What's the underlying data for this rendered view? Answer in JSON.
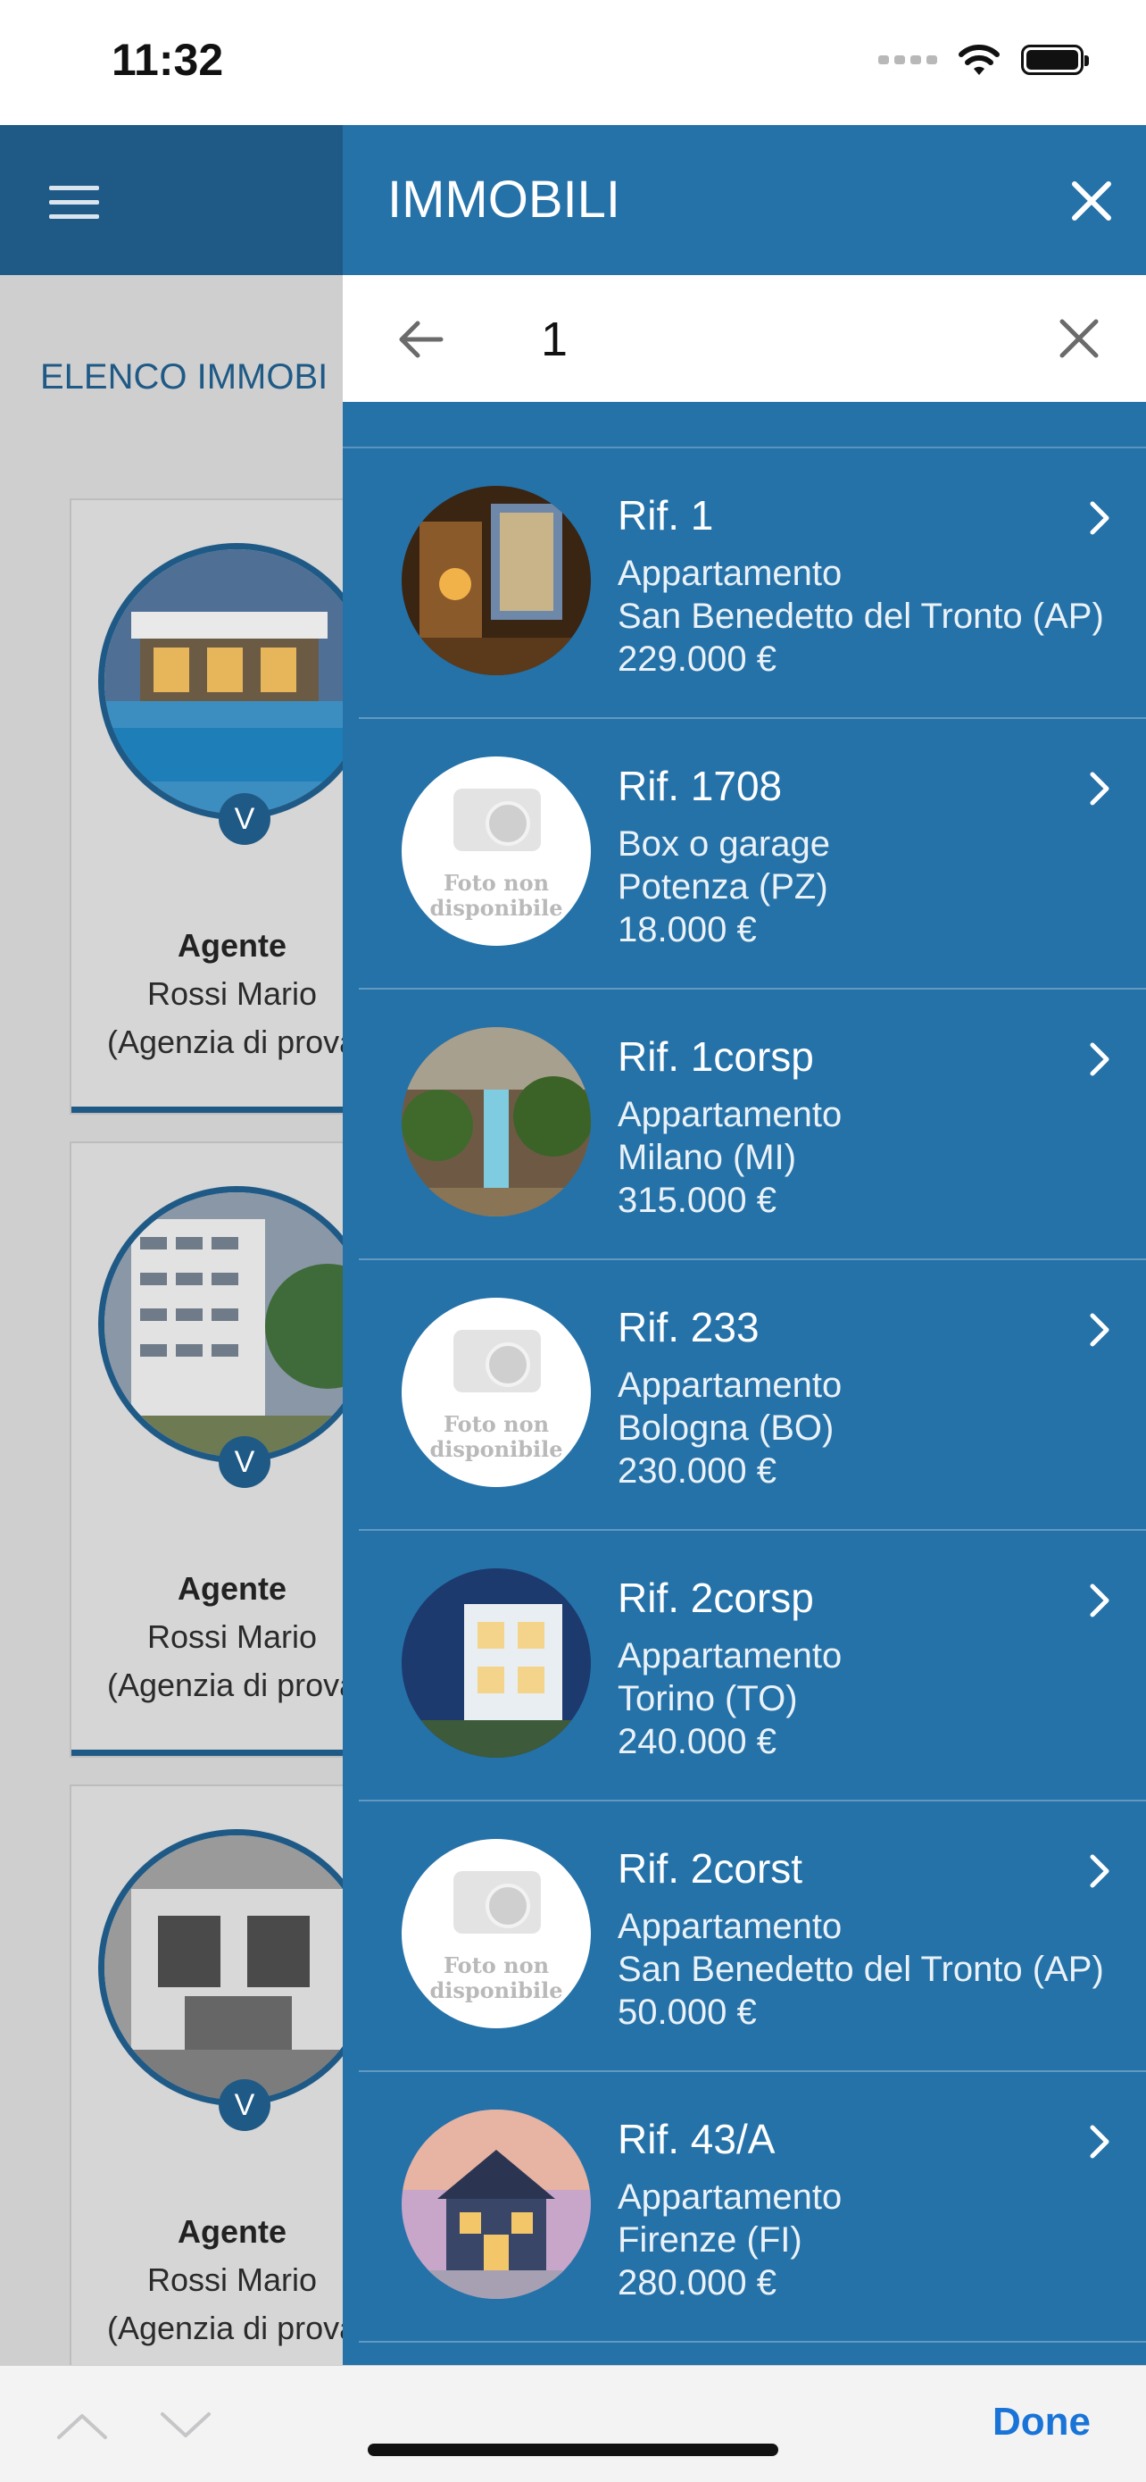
{
  "status_bar": {
    "time": "11:32"
  },
  "background_page": {
    "section_title": "ELENCO IMMOBI",
    "cards": [
      {
        "badge": "V",
        "agent_label": "Agente",
        "agent_name": "Rossi Mario",
        "agency": "(Agenzia di prova"
      },
      {
        "badge": "V",
        "agent_label": "Agente",
        "agent_name": "Rossi Mario",
        "agency": "(Agenzia di prova"
      },
      {
        "badge": "V",
        "agent_label": "Agente",
        "agent_name": "Rossi Mario",
        "agency": "(Agenzia di prova"
      }
    ]
  },
  "drawer": {
    "title": "IMMOBILI",
    "search": {
      "value": "1",
      "placeholder": ""
    },
    "items": [
      {
        "ref": "Rif. 1",
        "type": "Appartamento",
        "location": "San Benedetto del Tronto (AP)",
        "price": "229.000 €",
        "photo": "interior"
      },
      {
        "ref": "Rif. 1708",
        "type": "Box o garage",
        "location": "Potenza (PZ)",
        "price": "18.000 €",
        "photo": "none",
        "no_photo_text": "Foto non disponibile"
      },
      {
        "ref": "Rif. 1corsp",
        "type": "Appartamento",
        "location": "Milano (MI)",
        "price": "315.000 €",
        "photo": "resort"
      },
      {
        "ref": "Rif. 233",
        "type": "Appartamento",
        "location": "Bologna (BO)",
        "price": "230.000 €",
        "photo": "none",
        "no_photo_text": "Foto non disponibile"
      },
      {
        "ref": "Rif. 2corsp",
        "type": "Appartamento",
        "location": "Torino (TO)",
        "price": "240.000 €",
        "photo": "villa"
      },
      {
        "ref": "Rif. 2corst",
        "type": "Appartamento",
        "location": "San Benedetto del Tronto (AP)",
        "price": "50.000 €",
        "photo": "none",
        "no_photo_text": "Foto non disponibile"
      },
      {
        "ref": "Rif. 43/A",
        "type": "Appartamento",
        "location": "Firenze (FI)",
        "price": "280.000 €",
        "photo": "house"
      }
    ]
  },
  "accessory_bar": {
    "done_label": "Done"
  },
  "colors": {
    "drawer_bg": "#2572a9",
    "appbar_bg": "#1f5a86",
    "accent_link": "#1a74d8"
  },
  "icons": [
    "hamburger-icon",
    "close-icon",
    "back-arrow-icon",
    "clear-icon",
    "chevron-right-icon",
    "chevron-up-icon",
    "chevron-down-icon",
    "wifi-icon",
    "battery-icon"
  ]
}
